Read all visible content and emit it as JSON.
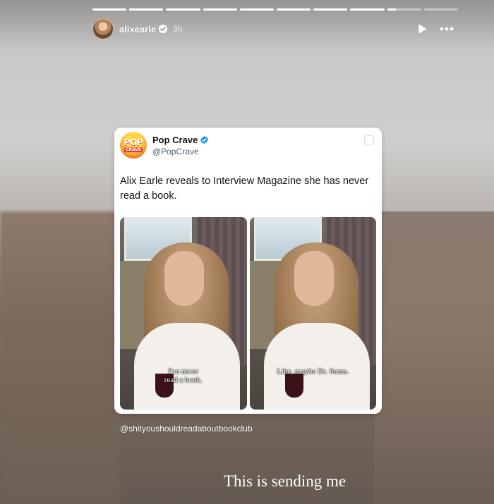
{
  "story": {
    "progress_segments": [
      1,
      1,
      1,
      1,
      1,
      1,
      1,
      1,
      0.25,
      0
    ],
    "user": {
      "username": "alixearle",
      "time": "3h"
    },
    "icons": {
      "verified": "verified-icon",
      "play": "play-icon",
      "more": "more-icon"
    }
  },
  "tweet": {
    "display_name": "Pop Crave",
    "handle": "@PopCrave",
    "logo_text": {
      "top": "POP",
      "bottom": "CRAVE"
    },
    "text": "Alix Earle reveals to Interview Magazine she has never read a book.",
    "photos": [
      {
        "caption_line1": "I've never",
        "caption_line2": "read a book."
      },
      {
        "caption_line1": "Like, maybe Dr. Seuss.",
        "caption_line2": ""
      }
    ]
  },
  "credit": "@shityoushouldreadaboutbookclub",
  "overlay_text": "This is sending me"
}
